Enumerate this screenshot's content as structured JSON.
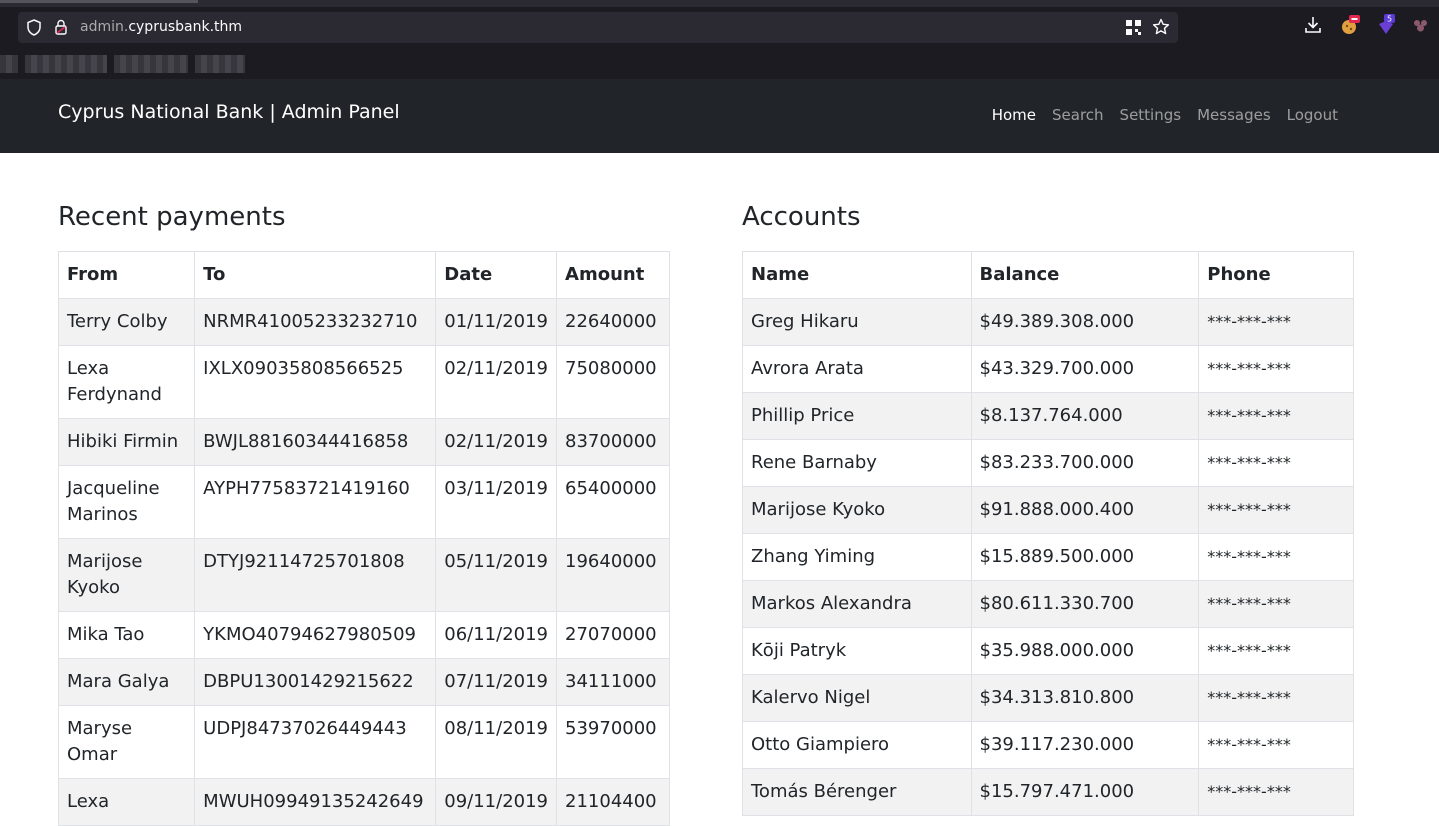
{
  "browser": {
    "url_prefix": "admin.",
    "url_host": "cyprusbank.thm",
    "extension_badge": "5"
  },
  "navbar": {
    "brand": "Cyprus National Bank | Admin Panel",
    "links": [
      "Home",
      "Search",
      "Settings",
      "Messages",
      "Logout"
    ],
    "active": "Home"
  },
  "payments": {
    "title": "Recent payments",
    "headers": [
      "From",
      "To",
      "Date",
      "Amount"
    ],
    "rows": [
      [
        "Terry Colby",
        "NRMR41005233232710",
        "01/11/2019",
        "22640000"
      ],
      [
        "Lexa Ferdynand",
        "IXLX09035808566525",
        "02/11/2019",
        "75080000"
      ],
      [
        "Hibiki Firmin",
        "BWJL88160344416858",
        "02/11/2019",
        "83700000"
      ],
      [
        "Jacqueline Marinos",
        "AYPH77583721419160",
        "03/11/2019",
        "65400000"
      ],
      [
        "Marijose Kyoko",
        "DTYJ92114725701808",
        "05/11/2019",
        "19640000"
      ],
      [
        "Mika Tao",
        "YKMO40794627980509",
        "06/11/2019",
        "27070000"
      ],
      [
        "Mara Galya",
        "DBPU13001429215622",
        "07/11/2019",
        "34111000"
      ],
      [
        "Maryse Omar",
        "UDPJ84737026449443",
        "08/11/2019",
        "53970000"
      ],
      [
        "Lexa",
        "MWUH09949135242649",
        "09/11/2019",
        "21104400"
      ]
    ]
  },
  "accounts": {
    "title": "Accounts",
    "headers": [
      "Name",
      "Balance",
      "Phone"
    ],
    "rows": [
      [
        "Greg Hikaru",
        "$49.389.308.000",
        "***-***-***"
      ],
      [
        "Avrora Arata",
        "$43.329.700.000",
        "***-***-***"
      ],
      [
        "Phillip Price",
        "$8.137.764.000",
        "***-***-***"
      ],
      [
        "Rene Barnaby",
        "$83.233.700.000",
        "***-***-***"
      ],
      [
        "Marijose Kyoko",
        "$91.888.000.400",
        "***-***-***"
      ],
      [
        "Zhang Yiming",
        "$15.889.500.000",
        "***-***-***"
      ],
      [
        "Markos Alexandra",
        "$80.611.330.700",
        "***-***-***"
      ],
      [
        "Kōji Patryk",
        "$35.988.000.000",
        "***-***-***"
      ],
      [
        "Kalervo Nigel",
        "$34.313.810.800",
        "***-***-***"
      ],
      [
        "Otto Giampiero",
        "$39.117.230.000",
        "***-***-***"
      ],
      [
        "Tomás Bérenger",
        "$15.797.471.000",
        "***-***-***"
      ]
    ]
  }
}
